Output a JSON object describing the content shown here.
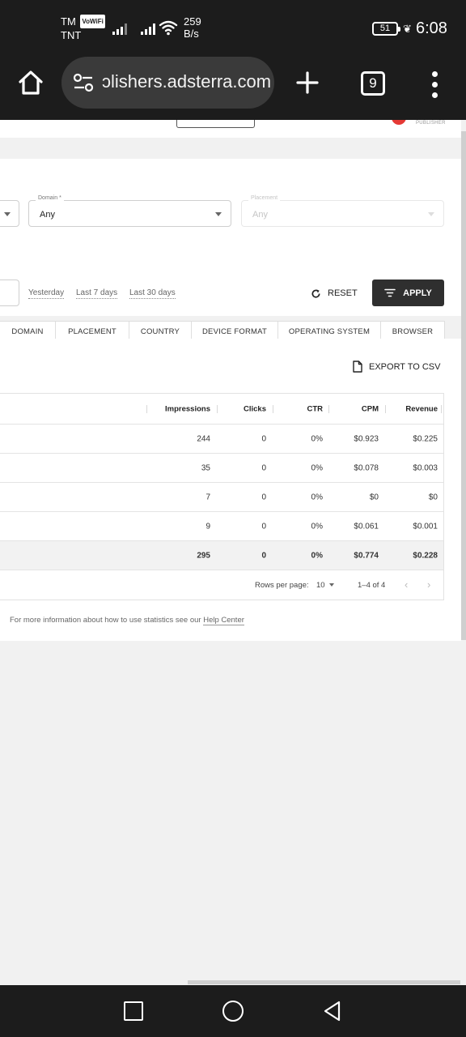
{
  "status_bar": {
    "carrier1": "TM",
    "vowifi": "VoWiFi",
    "carrier2": "TNT",
    "speed_value": "259",
    "speed_unit": "B/s",
    "battery": "51",
    "time": "6:08"
  },
  "browser": {
    "url": "ɔlishers.adsterra.com",
    "tab_count": "9"
  },
  "header": {
    "publisher_tag": "PUBLISHER"
  },
  "filters": {
    "domain_label": "Domain *",
    "domain_value": "Any",
    "placement_label": "Placement",
    "placement_value": "Any",
    "quick_dates": [
      "Yesterday",
      "Last 7 days",
      "Last 30 days"
    ],
    "reset_label": "RESET",
    "apply_label": "APPLY"
  },
  "group_by": [
    "DOMAIN",
    "PLACEMENT",
    "COUNTRY",
    "DEVICE FORMAT",
    "OPERATING SYSTEM",
    "BROWSER"
  ],
  "export_label": "EXPORT TO CSV",
  "table": {
    "columns": [
      "Impressions",
      "Clicks",
      "CTR",
      "CPM",
      "Revenue"
    ],
    "rows": [
      [
        "244",
        "0",
        "0%",
        "$0.923",
        "$0.225"
      ],
      [
        "35",
        "0",
        "0%",
        "$0.078",
        "$0.003"
      ],
      [
        "7",
        "0",
        "0%",
        "$0",
        "$0"
      ],
      [
        "9",
        "0",
        "0%",
        "$0.061",
        "$0.001"
      ]
    ],
    "total": [
      "295",
      "0",
      "0%",
      "$0.774",
      "$0.228"
    ]
  },
  "pagination": {
    "rows_per_page_label": "Rows per page:",
    "rows_per_page_value": "10",
    "range": "1–4 of 4"
  },
  "help": {
    "prefix": "For more information about how to use statistics see our ",
    "link": "Help Center"
  }
}
